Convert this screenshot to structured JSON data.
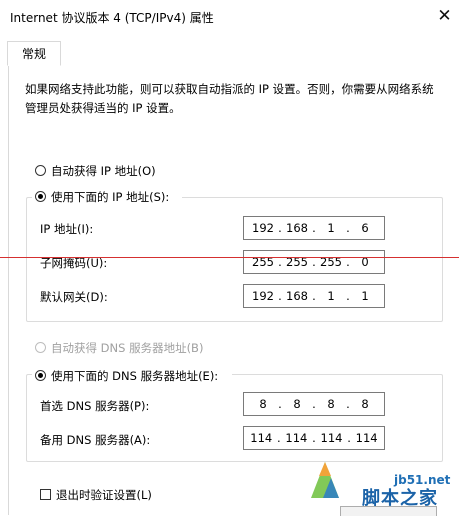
{
  "window": {
    "title": "Internet 协议版本 4 (TCP/IPv4) 属性",
    "close_glyph": "✕"
  },
  "tabs": [
    {
      "label": "常规"
    }
  ],
  "description": "如果网络支持此功能，则可以获取自动指派的 IP 设置。否则，你需要从网络系统管理员处获得适当的 IP 设置。",
  "ip_section": {
    "auto_option": "自动获得 IP 地址(O)",
    "manual_option": "使用下面的 IP 地址(S):",
    "fields": [
      {
        "label": "IP 地址(I):",
        "octets": [
          "192",
          "168",
          "1",
          "6"
        ]
      },
      {
        "label": "子网掩码(U):",
        "octets": [
          "255",
          "255",
          "255",
          "0"
        ]
      },
      {
        "label": "默认网关(D):",
        "octets": [
          "192",
          "168",
          "1",
          "1"
        ]
      }
    ]
  },
  "dns_section": {
    "auto_option": "自动获得 DNS 服务器地址(B)",
    "manual_option": "使用下面的 DNS 服务器地址(E):",
    "fields": [
      {
        "label": "首选 DNS 服务器(P):",
        "octets": [
          "8",
          "8",
          "8",
          "8"
        ]
      },
      {
        "label": "备用 DNS 服务器(A):",
        "octets": [
          "114",
          "114",
          "114",
          "114"
        ]
      }
    ]
  },
  "validate_on_exit": "退出时验证设置(L)",
  "watermark": {
    "url": "jb51.net",
    "text": "脚本之家"
  },
  "colors": {
    "red_line": "#d53030",
    "watermark_blue": "#1b63a8"
  }
}
